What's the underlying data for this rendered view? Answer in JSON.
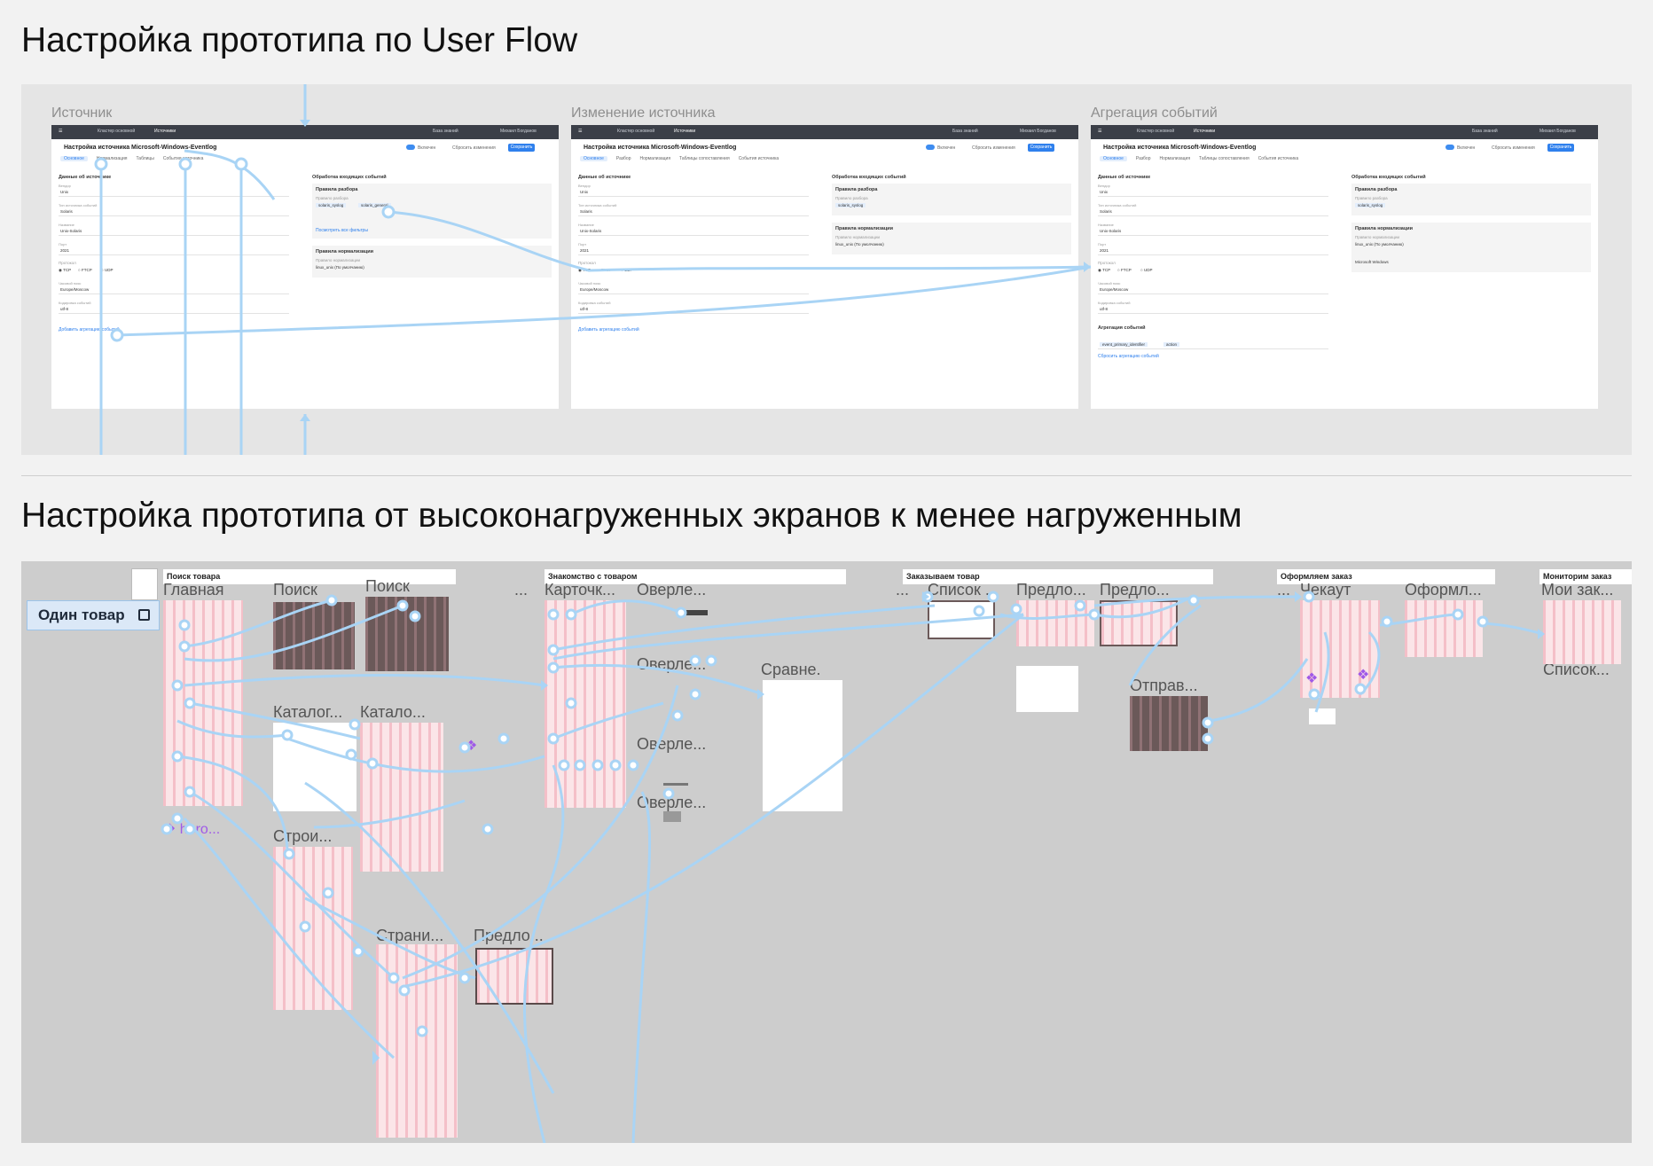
{
  "section1": {
    "title": "Настройка прототипа по User Flow",
    "frames": [
      {
        "label": "Источник",
        "topbar_items": [
          "Кластер основной",
          "Источники",
          "База знаний",
          "Михаил Богданов"
        ],
        "header_title": "Настройка источника Microsoft-Windows-Eventlog",
        "toggle_label": "Включен",
        "reset_label": "Сбросить изменения",
        "save_label": "Сохранить",
        "tabs": [
          "Основное",
          "Нормализация",
          "Таблицы",
          "События источника"
        ],
        "left_section": "Данные об источнике",
        "fields": [
          {
            "label": "Вендор",
            "value": "Unix"
          },
          {
            "label": "Тип источника событий",
            "value": "Solaris"
          },
          {
            "label": "Название",
            "value": "Unix-Solaris"
          },
          {
            "label": "Порт",
            "value": "2021"
          }
        ],
        "protocol_label": "Протокол",
        "protocols": [
          "TCP",
          "FTCP",
          "UDP"
        ],
        "extra_fields": [
          {
            "label": "Часовой пояс",
            "value": "Europe/Moscow"
          },
          {
            "label": "Кодировка событий",
            "value": "utf-8"
          }
        ],
        "add_link": "Добавить агрегацию событий",
        "right_section": "Обработка входящих событий",
        "right_groups": [
          {
            "title": "Правила разбора",
            "sub": "Правило разбора",
            "chips": [
              "solaris_syslog",
              "solaris_general"
            ]
          },
          {
            "title": "Правила нормализации",
            "sub": "Правило нормализации",
            "chips": [
              "linux_unix (По умолчанию)"
            ]
          }
        ],
        "right_link": "Посмотреть все фильтры"
      },
      {
        "label": "Изменение источника",
        "topbar_items": [
          "Кластер основной",
          "Источники",
          "База знаний",
          "Михаил Богданов"
        ],
        "header_title": "Настройка источника Microsoft-Windows-Eventlog",
        "toggle_label": "Включен",
        "reset_label": "Сбросить изменения",
        "save_label": "Сохранить",
        "tabs": [
          "Основное",
          "Разбор",
          "Нормализация",
          "Таблицы сопоставления",
          "События источника"
        ],
        "left_section": "Данные об источнике",
        "fields": [
          {
            "label": "Вендор",
            "value": "Unix"
          },
          {
            "label": "Тип источника событий",
            "value": "Solaris"
          },
          {
            "label": "Название",
            "value": "Unix-Solaris"
          },
          {
            "label": "Порт",
            "value": "2021"
          }
        ],
        "protocol_label": "Протокол",
        "protocols": [
          "TCP",
          "FTCP",
          "UDP"
        ],
        "extra_fields": [
          {
            "label": "Часовой пояс",
            "value": "Europe/Moscow"
          },
          {
            "label": "Кодировка событий",
            "value": "utf-8"
          }
        ],
        "add_link": "Добавить агрегацию событий",
        "right_section": "Обработка входящих событий",
        "right_groups": [
          {
            "title": "Правила разбора",
            "sub": "Правило разбора",
            "chips": [
              "solaris_syslog"
            ]
          },
          {
            "title": "Правила нормализации",
            "sub": "Правило нормализации",
            "chips": [
              "linux_unix (По умолчанию)"
            ]
          }
        ],
        "right_link": ""
      },
      {
        "label": "Агрегация событий",
        "topbar_items": [
          "Кластер основной",
          "Источники",
          "База знаний",
          "Михаил Богданов"
        ],
        "header_title": "Настройка источника Microsoft-Windows-Eventlog",
        "toggle_label": "Включен",
        "reset_label": "Сбросить изменения",
        "save_label": "Сохранить",
        "tabs": [
          "Основное",
          "Разбор",
          "Нормализация",
          "Таблицы сопоставления",
          "События источника"
        ],
        "left_section": "Данные об источнике",
        "fields": [
          {
            "label": "Вендор",
            "value": "Unix"
          },
          {
            "label": "Тип источника событий",
            "value": "Solaris"
          },
          {
            "label": "Название",
            "value": "Unix-Solaris"
          },
          {
            "label": "Порт",
            "value": "2021"
          }
        ],
        "protocol_label": "Протокол",
        "protocols": [
          "TCP",
          "FTCP",
          "UDP"
        ],
        "extra_fields": [
          {
            "label": "Часовой пояс",
            "value": "Europe/Moscow"
          },
          {
            "label": "Кодировка событий",
            "value": "utf-8"
          }
        ],
        "add_link": "Сбросить агрегацию событий",
        "aggregation_section": "Агрегация событий",
        "aggregation_chips": [
          "event_primary_identifier",
          "action"
        ],
        "right_section": "Обработка входящих событий",
        "right_groups": [
          {
            "title": "Правила разбора",
            "sub": "Правило разбора",
            "chips": [
              "solaris_syslog"
            ]
          },
          {
            "title": "Правила нормализации",
            "sub": "Правило нормализации",
            "chips": [
              "linux_unix (По умолчанию)",
              "Microsoft Windows"
            ]
          }
        ],
        "right_link": ""
      }
    ]
  },
  "section2": {
    "title": "Настройка прототипа от высоконагруженных экранов к менее нагруженным",
    "badge": "Один товар",
    "section_headers": [
      "Поиск товара",
      "Знакомство с товаром",
      "Заказываем товар",
      "Оформляем заказ",
      "Мониторим заказ"
    ],
    "frame_labels": [
      "Главная",
      "Поиск",
      "Поиск",
      "Каталог...",
      "Катало...",
      "Строи...",
      "Страни...",
      "Предло...",
      "Карточк...",
      "Оверле...",
      "Оверле...",
      "Сравне.",
      "Оверле...",
      "Оверле...",
      "Список ...",
      "Предло...",
      "Предло...",
      "Отправ...",
      "Чекаут",
      "Оформл...",
      "Мои зак...",
      "Список...",
      "hero...",
      "..."
    ]
  }
}
